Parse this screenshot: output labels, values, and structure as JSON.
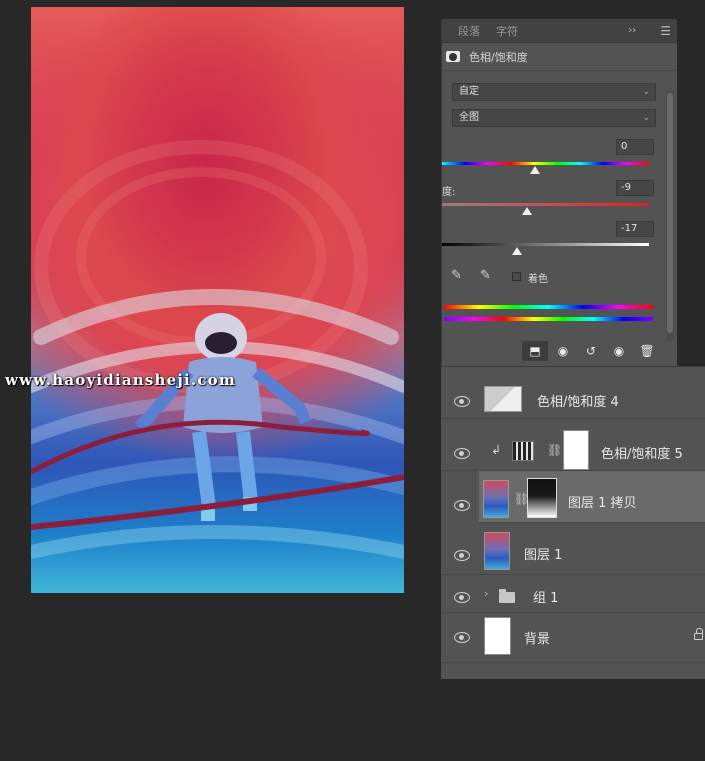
{
  "properties": {
    "tabs": [
      "段落",
      "字符"
    ],
    "expand_glyph": "››",
    "title": "色相/饱和度",
    "preset_value": "自定",
    "channel_value": "全图",
    "params": [
      {
        "label": "",
        "value": "0"
      },
      {
        "label": "度:",
        "value": "-9"
      },
      {
        "label": "",
        "value": "-17"
      }
    ],
    "hue_position": 0.45,
    "saturation_position": 0.41,
    "lightness_position": 0.36,
    "colorize_label": "着色",
    "colors": {
      "panel": "#535353",
      "header": "#424242",
      "field": "#464646"
    }
  },
  "layers": [
    {
      "name": "色相/饱和度 4",
      "type": "adjustment",
      "visible": true
    },
    {
      "name": "色相/饱和度 5",
      "type": "adjustment-clipped",
      "visible": true
    },
    {
      "name": "图层 1 拷贝",
      "type": "pixel-with-mask",
      "visible": true,
      "selected": true
    },
    {
      "name": "图层 1",
      "type": "pixel",
      "visible": true
    },
    {
      "name": "组 1",
      "type": "group",
      "visible": true
    },
    {
      "name": "背景",
      "type": "background",
      "visible": true,
      "locked": true
    }
  ],
  "watermark": "www.haoyidiansheji.com"
}
